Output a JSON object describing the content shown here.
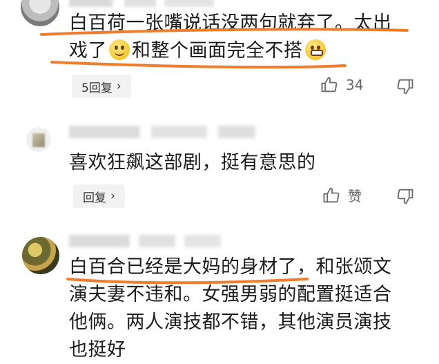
{
  "comments": [
    {
      "lines": [
        "白百荷一张嘴说话没两句就弃了。太出",
        [
          "戏了",
          "和整个画面完全不搭"
        ]
      ],
      "reply_label": "5回复",
      "like_count": "34"
    },
    {
      "lines": [
        "喜欢狂飙这部剧，挺有意思的"
      ],
      "reply_label": "回复",
      "like_label": "赞"
    },
    {
      "lines": [
        "白百合已经是大妈的身材了，和张颂文",
        "演夫妻不违和。女强男弱的配置挺适合",
        "他俩。两人演技都不错，其他演员演技",
        "也挺好"
      ]
    }
  ],
  "icons": {
    "like": "thumbs-up-icon",
    "dislike": "thumbs-down-icon",
    "chevron": "chevron-right-icon",
    "emoji_1": "grinning-face-icon",
    "emoji_2": "grimacing-face-icon"
  },
  "colors": {
    "underline": "#ef7d2c",
    "reply_bg": "#f2f2f2",
    "icon": "#6b6b6b"
  }
}
